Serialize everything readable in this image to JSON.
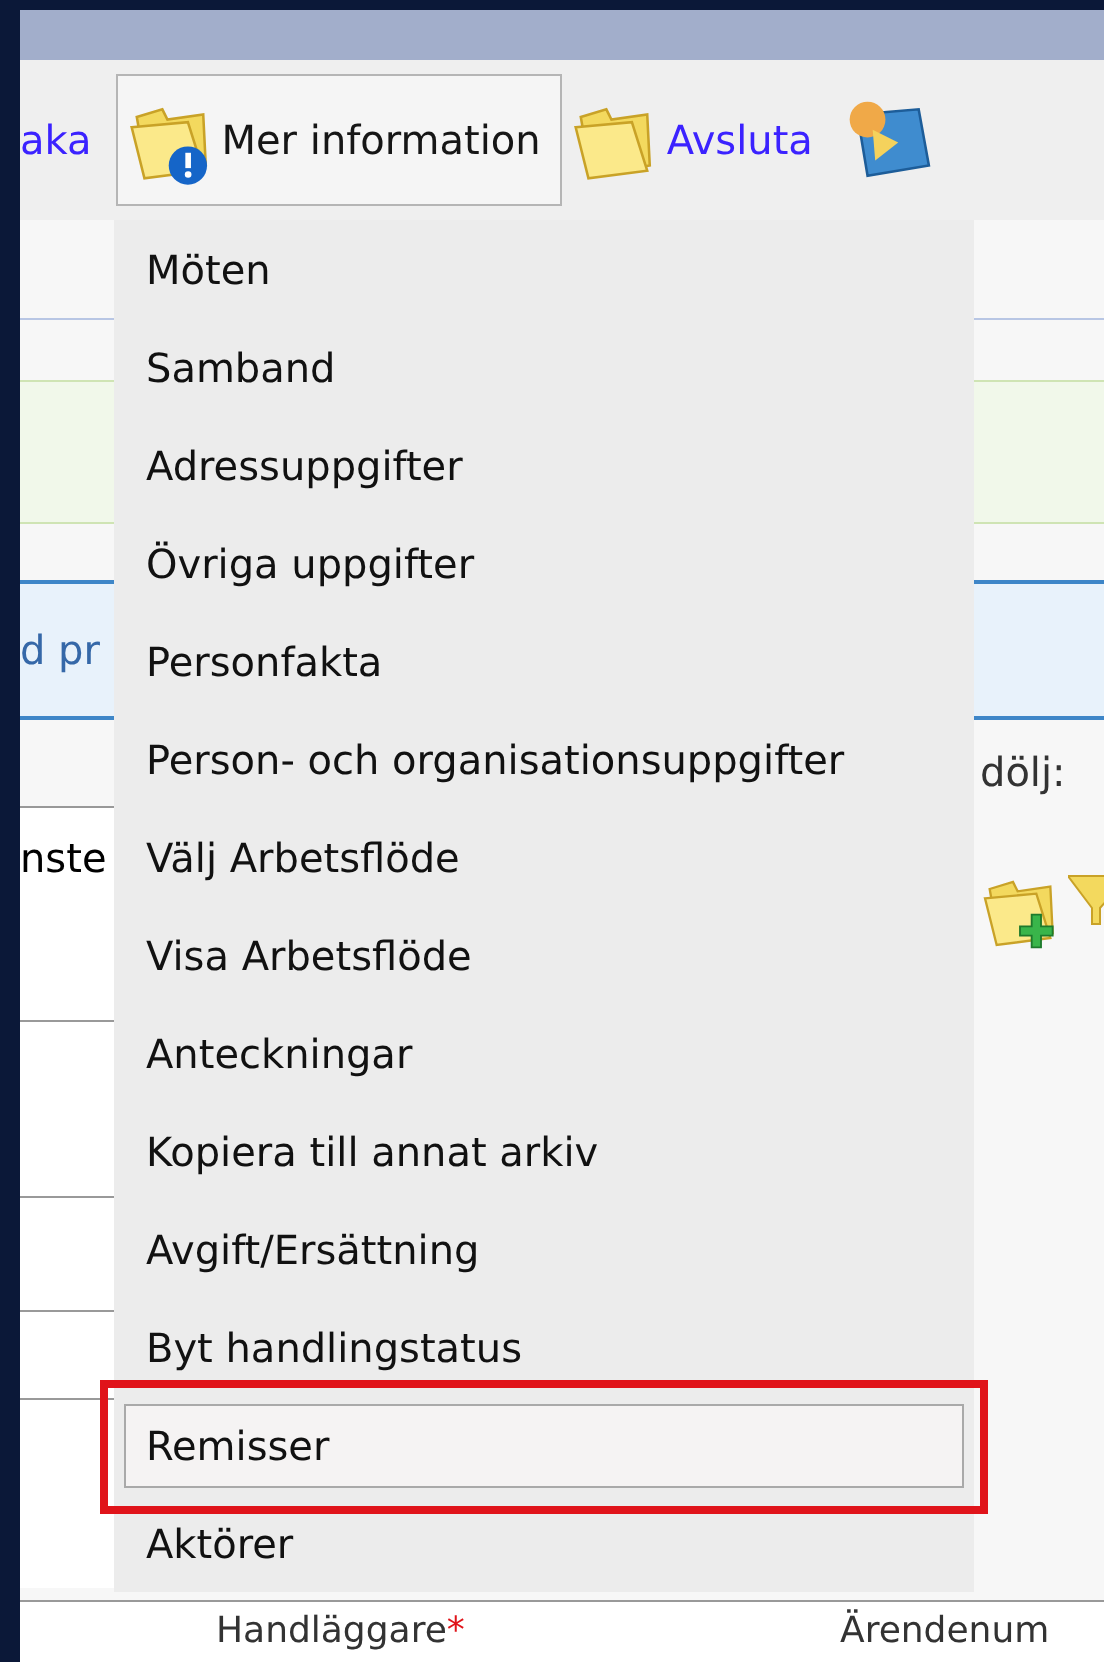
{
  "toolbar": {
    "items": [
      {
        "kind": "link",
        "label": "aka"
      },
      {
        "kind": "menu-button",
        "label": "Mer information",
        "expanded": true
      },
      {
        "kind": "link",
        "label": "Avsluta"
      },
      {
        "kind": "icon-button"
      }
    ]
  },
  "menu": {
    "items": [
      {
        "label": "Möten",
        "selected": false
      },
      {
        "label": "Samband",
        "selected": false
      },
      {
        "label": "Adressuppgifter",
        "selected": false
      },
      {
        "label": "Övriga uppgifter",
        "selected": false
      },
      {
        "label": "Personfakta",
        "selected": false
      },
      {
        "label": "Person- och organisationsuppgifter",
        "selected": false
      },
      {
        "label": "Välj Arbetsflöde",
        "selected": false
      },
      {
        "label": "Visa Arbetsflöde",
        "selected": false
      },
      {
        "label": "Anteckningar",
        "selected": false
      },
      {
        "label": "Kopiera till annat arkiv",
        "selected": false
      },
      {
        "label": "Avgift/Ersättning",
        "selected": false
      },
      {
        "label": "Byt handlingstatus",
        "selected": false
      },
      {
        "label": "Remisser",
        "selected": true
      },
      {
        "label": "Aktörer",
        "selected": false
      }
    ]
  },
  "info_band": {
    "text": "d pr"
  },
  "side_label": "dölj:",
  "row_text": "nste",
  "form_labels": [
    {
      "label": "Handläggare",
      "mark": "*"
    },
    {
      "label": "Ärendenum"
    }
  ]
}
